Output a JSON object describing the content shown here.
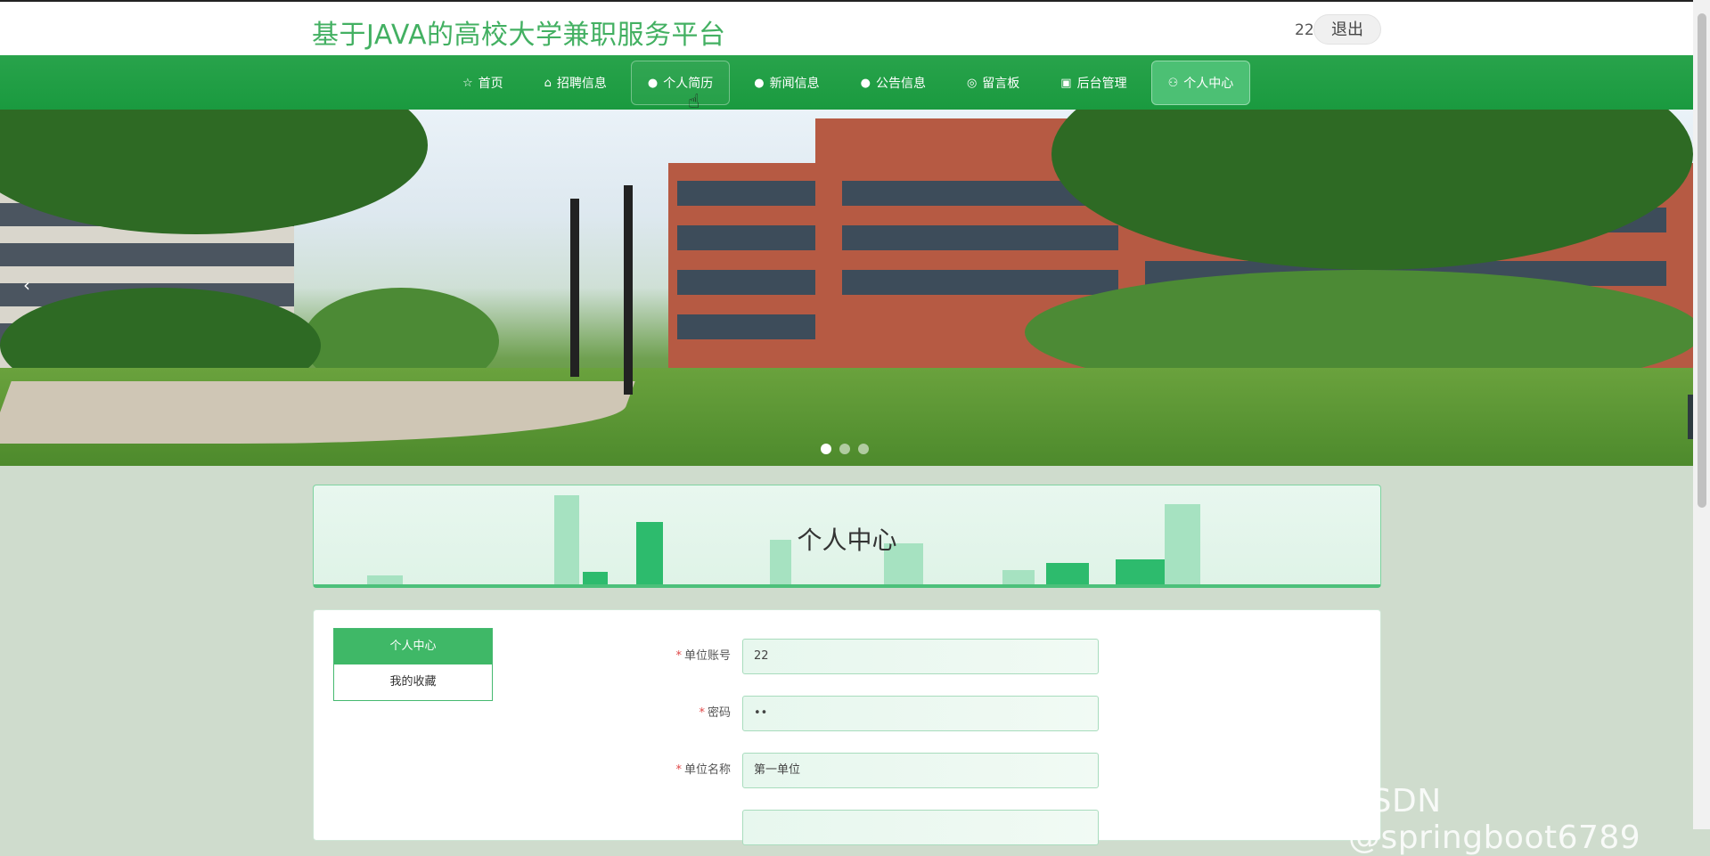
{
  "header": {
    "site_title": "基于JAVA的高校大学兼职服务平台",
    "user_name": "22",
    "logout_label": "退出"
  },
  "nav": {
    "items": [
      {
        "icon": "star-icon",
        "glyph": "☆",
        "label": "首页"
      },
      {
        "icon": "bag-icon",
        "glyph": "⌂",
        "label": "招聘信息"
      },
      {
        "icon": "info-icon",
        "glyph": "●",
        "label": "个人简历"
      },
      {
        "icon": "question-icon",
        "glyph": "●",
        "label": "新闻信息"
      },
      {
        "icon": "info-circle-icon",
        "glyph": "●",
        "label": "公告信息"
      },
      {
        "icon": "chat-icon",
        "glyph": "◎",
        "label": "留言板"
      },
      {
        "icon": "box-icon",
        "glyph": "▣",
        "label": "后台管理"
      },
      {
        "icon": "user-icon",
        "glyph": "⚇",
        "label": "个人中心"
      }
    ],
    "active_index": 7,
    "hover_index": 2
  },
  "banner": {
    "prev_glyph": "‹",
    "slide_count": 3,
    "active_slide": 1
  },
  "section": {
    "title": "个人中心"
  },
  "side_menu": {
    "items": [
      "个人中心",
      "我的收藏"
    ],
    "active_index": 0
  },
  "form": {
    "fields": [
      {
        "label": "单位账号",
        "value": "22",
        "required": true
      },
      {
        "label": "密码",
        "value": "••",
        "required": true
      },
      {
        "label": "单位名称",
        "value": "第一单位",
        "required": true
      },
      {
        "label": "",
        "value": "",
        "required": false
      }
    ]
  },
  "side_tab_glyph": "‹",
  "watermark": "CSDN @springboot6789",
  "colors": {
    "brand_green": "#43b062",
    "nav_green": "#1f9e45",
    "active_green": "#3fb867",
    "required_red": "#e04848"
  }
}
